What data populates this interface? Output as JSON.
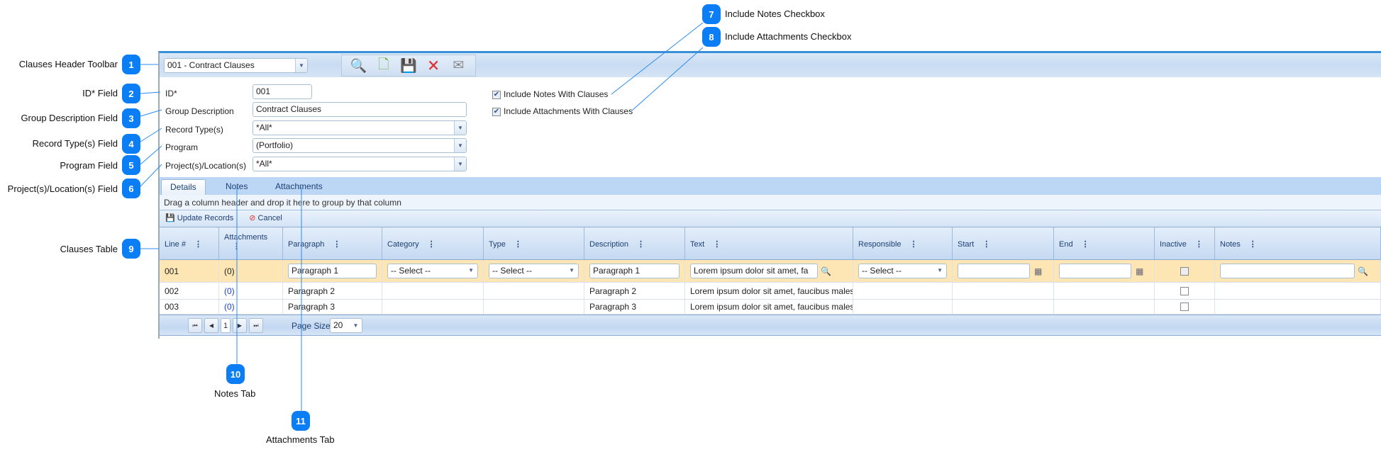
{
  "annotations": [
    {
      "n": "1",
      "label": "Clauses Header Toolbar"
    },
    {
      "n": "2",
      "label": "ID* Field"
    },
    {
      "n": "3",
      "label": "Group Description Field"
    },
    {
      "n": "4",
      "label": "Record Type(s) Field"
    },
    {
      "n": "5",
      "label": "Program Field"
    },
    {
      "n": "6",
      "label": "Project(s)/Location(s) Field"
    },
    {
      "n": "7",
      "label": "Include Notes Checkbox"
    },
    {
      "n": "8",
      "label": "Include Attachments Checkbox"
    },
    {
      "n": "9",
      "label": "Clauses Table"
    },
    {
      "n": "10",
      "label": "Notes Tab"
    },
    {
      "n": "11",
      "label": "Attachments Tab"
    }
  ],
  "toolbar": {
    "selector_value": "001 - Contract Clauses",
    "icons": [
      "search-icon",
      "add-document-icon",
      "save-icon",
      "delete-document-icon",
      "email-icon"
    ]
  },
  "form": {
    "id_label": "ID*",
    "id_value": "001",
    "group_label": "Group Description",
    "group_value": "Contract Clauses",
    "record_label": "Record Type(s)",
    "record_value": "*All*",
    "program_label": "Program",
    "program_value": "(Portfolio)",
    "project_label": "Project(s)/Location(s)",
    "project_value": "*All*",
    "include_notes_label": "Include Notes With Clauses",
    "include_notes_checked": true,
    "include_attachments_label": "Include Attachments With Clauses",
    "include_attachments_checked": true
  },
  "tabs": [
    "Details",
    "Notes",
    "Attachments"
  ],
  "grid": {
    "group_hint": "Drag a column header and drop it here to group by that column",
    "update_label": "Update Records",
    "cancel_label": "Cancel",
    "columns": [
      "Line #",
      "Attachments",
      "Paragraph",
      "Category",
      "Type",
      "Description",
      "Text",
      "Responsible",
      "Start",
      "End",
      "Inactive",
      "Notes"
    ],
    "edit_row": {
      "line": "001",
      "attachments": "(0)",
      "paragraph": "Paragraph 1",
      "category": "-- Select --",
      "type": "-- Select --",
      "description": "Paragraph 1",
      "text": "Lorem ipsum dolor sit amet, fa",
      "responsible": "-- Select --",
      "start": "",
      "end": "",
      "notes": ""
    },
    "rows": [
      {
        "line": "002",
        "attachments": "(0)",
        "paragraph": "Paragraph 2",
        "description": "Paragraph 2",
        "text": "Lorem ipsum dolor sit amet, faucibus males",
        "inactive": false
      },
      {
        "line": "003",
        "attachments": "(0)",
        "paragraph": "Paragraph 3",
        "description": "Paragraph 3",
        "text": "Lorem ipsum dolor sit amet, faucibus males",
        "inactive": false
      }
    ],
    "page": "1",
    "page_size_label": "Page Size",
    "page_size": "20"
  },
  "colors": {
    "accent": "#0b7ef5",
    "selected_row": "#fde5b4",
    "header": "#c4d9f2"
  }
}
